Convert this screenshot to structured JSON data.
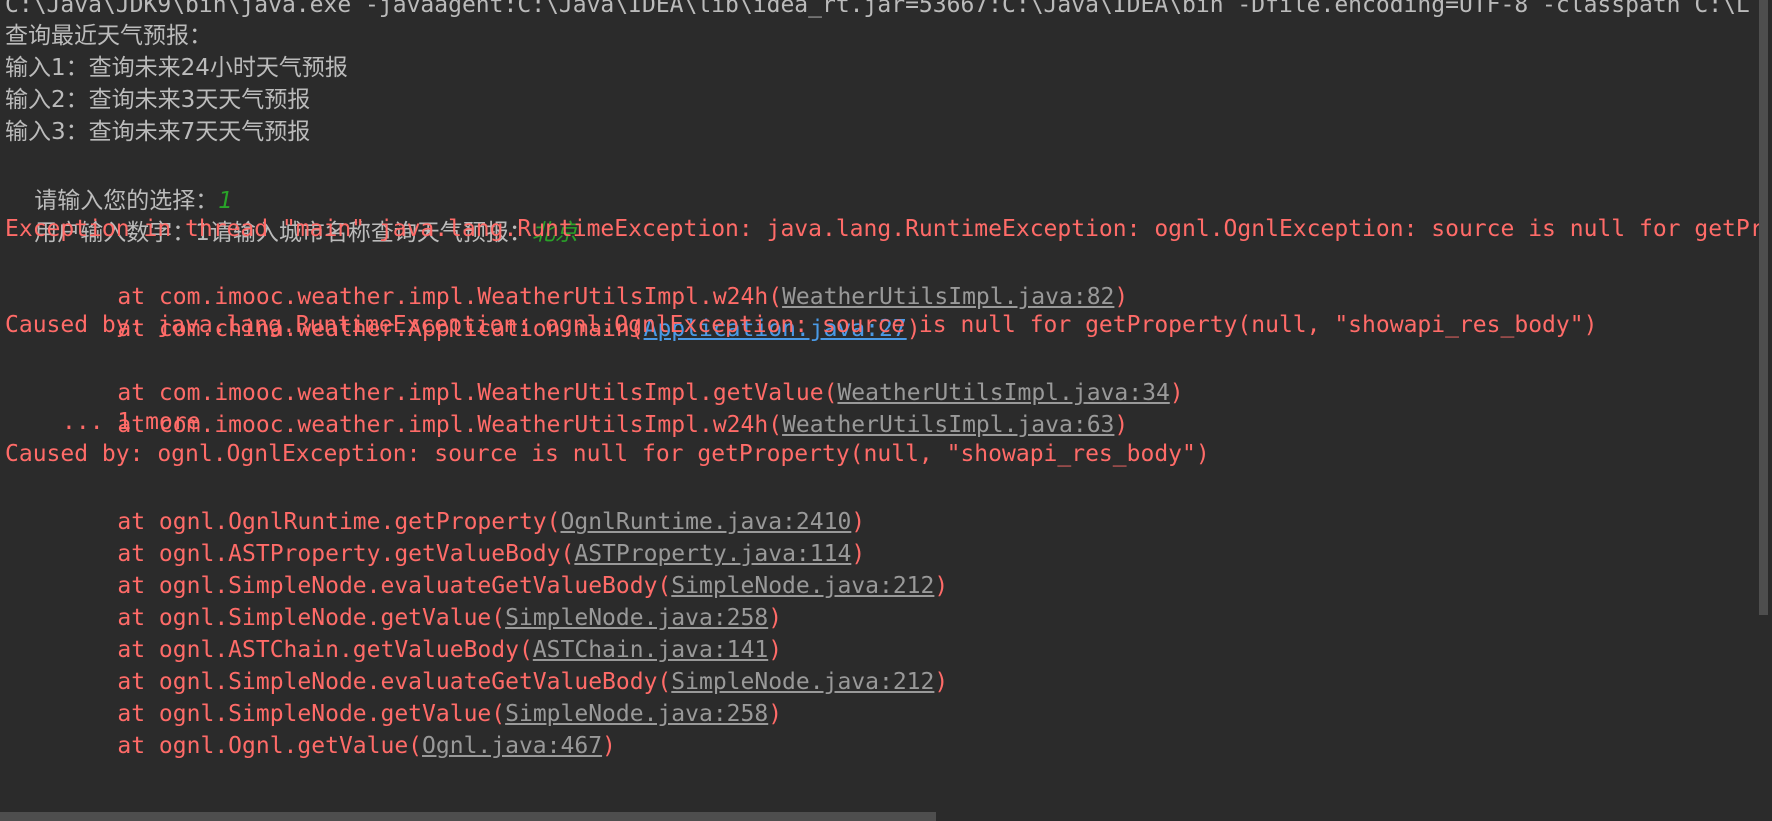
{
  "command": "C:\\Java\\JDK9\\bin\\java.exe -javaagent:C:\\Java\\IDEA\\lib\\idea_rt.jar=53667:C:\\Java\\IDEA\\bin -Dfile.encoding=UTF-8 -classpath C:\\L",
  "menu": {
    "title": "查询最近天气预报：",
    "option1": "输入1：查询未来24小时天气预报",
    "option2": "输入2：查询未来3天天气预报",
    "option3": "输入3：查询未来7天天气预报",
    "prompt_choice": "请输入您的选择：",
    "choice_value": "1",
    "user_input_text": "用户输入数字：1请输入城市名称查询天气预报：",
    "city_value": "北京"
  },
  "stacktrace": {
    "exception_line": "Exception in thread \"main\" java.lang.RuntimeException: java.lang.RuntimeException: ognl.OgnlException: source is null for getPr",
    "frames_1": [
      {
        "prefix": "at com.imooc.weather.impl.WeatherUtilsImpl.w24h(",
        "link": "WeatherUtilsImpl.java:82",
        "suffix": ")"
      },
      {
        "prefix": "at com.china.weather.Application.main(",
        "link": "Application.java:27",
        "suffix": ")"
      }
    ],
    "caused_by_1": "Caused by: java.lang.RuntimeException: ognl.OgnlException: source is null for getProperty(null, \"showapi_res_body\")",
    "frames_2": [
      {
        "prefix": "at com.imooc.weather.impl.WeatherUtilsImpl.getValue(",
        "link": "WeatherUtilsImpl.java:34",
        "suffix": ")"
      },
      {
        "prefix": "at com.imooc.weather.impl.WeatherUtilsImpl.w24h(",
        "link": "WeatherUtilsImpl.java:63",
        "suffix": ")"
      }
    ],
    "more": "... 1 more",
    "caused_by_2": "Caused by: ognl.OgnlException: source is null for getProperty(null, \"showapi_res_body\")",
    "frames_3": [
      {
        "prefix": "at ognl.OgnlRuntime.getProperty(",
        "link": "OgnlRuntime.java:2410",
        "suffix": ")"
      },
      {
        "prefix": "at ognl.ASTProperty.getValueBody(",
        "link": "ASTProperty.java:114",
        "suffix": ")"
      },
      {
        "prefix": "at ognl.SimpleNode.evaluateGetValueBody(",
        "link": "SimpleNode.java:212",
        "suffix": ")"
      },
      {
        "prefix": "at ognl.SimpleNode.getValue(",
        "link": "SimpleNode.java:258",
        "suffix": ")"
      },
      {
        "prefix": "at ognl.ASTChain.getValueBody(",
        "link": "ASTChain.java:141",
        "suffix": ")"
      },
      {
        "prefix": "at ognl.SimpleNode.evaluateGetValueBody(",
        "link": "SimpleNode.java:212",
        "suffix": ")"
      },
      {
        "prefix": "at ognl.SimpleNode.getValue(",
        "link": "SimpleNode.java:258",
        "suffix": ")"
      },
      {
        "prefix": "at ognl.Ognl.getValue(",
        "link": "Ognl.java:467",
        "suffix": ")"
      }
    ]
  },
  "colors": {
    "background": "#2b2b2b",
    "output_text": "#bbbbbb",
    "error_text": "#ff6b68",
    "user_input": "#29a329",
    "link": "#999999",
    "link_active": "#4a9ae6"
  }
}
